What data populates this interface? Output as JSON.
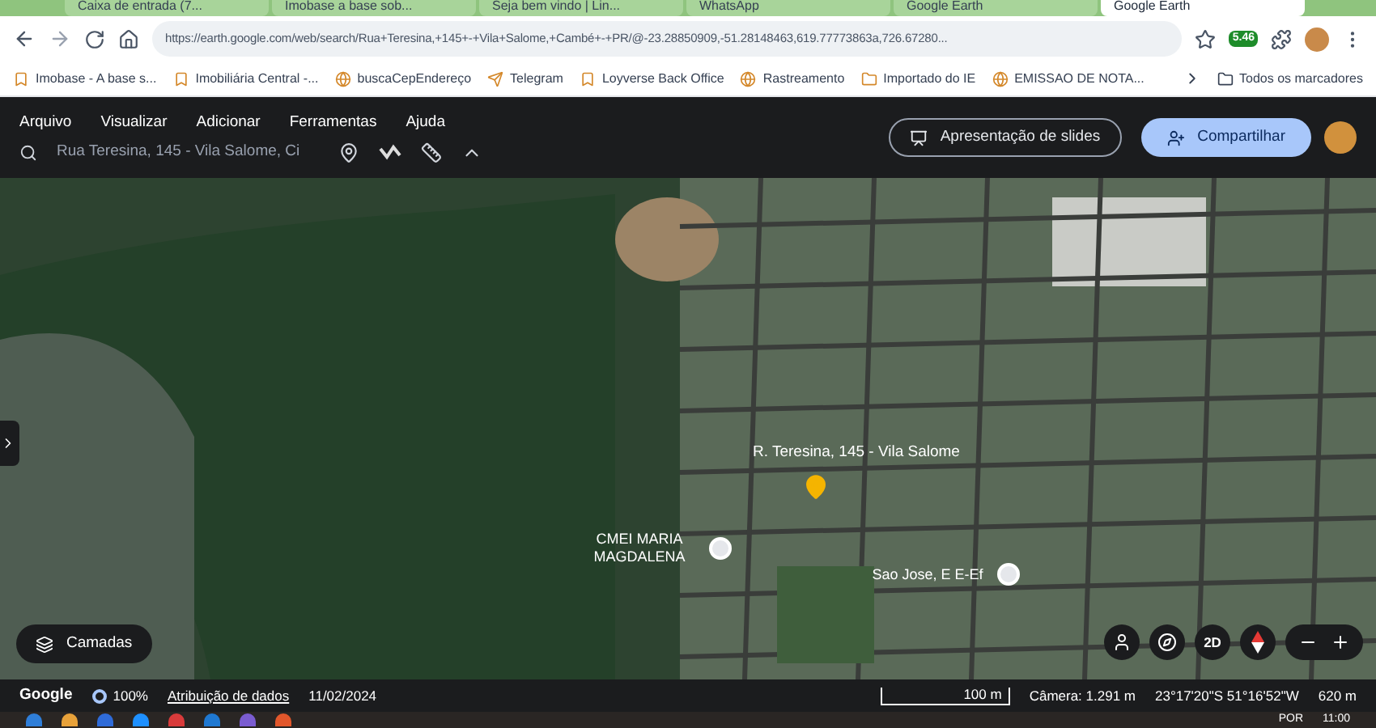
{
  "browser": {
    "tabs": [
      {
        "label": "Caixa de entrada (7...",
        "selected": false
      },
      {
        "label": "Imobase a base sob...",
        "selected": false
      },
      {
        "label": "Seja bem vindo | Lin...",
        "selected": false
      },
      {
        "label": "WhatsApp",
        "selected": false
      },
      {
        "label": "Google Earth",
        "selected": false
      },
      {
        "label": "Google Earth",
        "selected": true
      }
    ],
    "address": "https://earth.google.com/web/search/Rua+Teresina,+145+-+Vila+Salome,+Cambé+-+PR/@-23.28850909,-51.28148463,619.77773863a,726.67280...",
    "extension_badge": "5.46",
    "bookmarks": [
      "Imobase - A base s...",
      "Imobiliária Central -...",
      "buscaCepEndereço",
      "Telegram",
      "Loyverse Back Office",
      "Rastreamento",
      "Importado do IE",
      "EMISSAO DE NOTA..."
    ],
    "all_bookmarks": "Todos os marcadores"
  },
  "earth": {
    "menus": [
      "Arquivo",
      "Visualizar",
      "Adicionar",
      "Ferramentas",
      "Ajuda"
    ],
    "search": {
      "value": "Rua Teresina, 145 - Vila Salome, Ci"
    },
    "slides_button": "Apresentação de slides",
    "share_button": "Compartilhar"
  },
  "map": {
    "labels": [
      {
        "text": "R. Teresina, 145 - Vila Salome",
        "kind": "street"
      },
      {
        "text": "CMEI MARIA MAGDALENA",
        "kind": "poi"
      },
      {
        "text": "Sao Jose, E E-Ef",
        "kind": "poi"
      }
    ],
    "layers_button": "Camadas",
    "view_button": "2D"
  },
  "status_bar": {
    "logo": "Google",
    "quality": "100%",
    "attribution": "Atribuição de dados",
    "date": "11/02/2024",
    "scale": "100 m",
    "camera": "Câmera: 1.291 m",
    "coordinates": "23°17'20\"S 51°16'52\"W",
    "altitude": "620 m"
  },
  "taskbar": {
    "language": "POR",
    "time": "11:00"
  }
}
